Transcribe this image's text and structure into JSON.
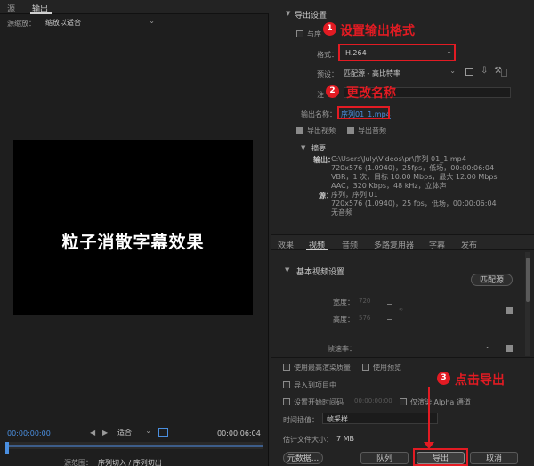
{
  "left_panel": {
    "tab_source": "源",
    "tab_output": "输出",
    "source_zoom_label": "源缩放：",
    "source_zoom_value": "缩放以适合",
    "video_text": "粒子消散字幕效果",
    "timecode_start": "00:00:00:00",
    "fit_value": "适合",
    "timecode_end": "00:00:06:04",
    "source_range_label": "源范围：",
    "source_range_value": "序列切入 / 序列切出"
  },
  "export_settings": {
    "section_title": "导出设置",
    "match_sequence_label": "与序",
    "format_label": "格式：",
    "format_value": "H.264",
    "preset_label": "预设：",
    "preset_value": "匹配源 - 高比特率",
    "comment_label": "注",
    "output_name_label": "输出名称：",
    "output_name_value": "序列01_1.mp4",
    "export_video_label": "导出视频",
    "export_audio_label": "导出音频"
  },
  "summary": {
    "title": "摘要",
    "output_label": "输出：",
    "output_lines": [
      "C:\\Users\\July\\Videos\\pr\\序列 01_1.mp4",
      "720x576 (1.0940)，25fps，低场，00:00:06:04",
      "VBR，1 次，目标 10.00 Mbps，最大 12.00 Mbps",
      "AAC，320 Kbps，48 kHz，立体声"
    ],
    "source_label": "源：",
    "source_lines": [
      "序列，序列 01",
      "720x576 (1.0940)，25 fps，低场，00:00:06:04",
      "无音频"
    ]
  },
  "tabs": [
    "效果",
    "视频",
    "音频",
    "多路复用器",
    "字幕",
    "发布"
  ],
  "video_settings": {
    "title": "基本视频设置",
    "match_source_button": "匹配源",
    "width_label": "宽度：",
    "width_value": "720",
    "height_label": "高度：",
    "height_value": "576",
    "framerate_label": "帧速率："
  },
  "options": {
    "max_render_quality": "使用最高渲染质量",
    "use_previews": "使用预览",
    "import_into_project": "导入到项目中",
    "set_start_timecode": "设置开始时间码",
    "start_timecode_value": "00:00:00:00",
    "render_alpha_only": "仅渲染 Alpha 通道",
    "time_interp_label": "时间插值：",
    "time_interp_value": "帧采样",
    "est_file_size_label": "估计文件大小：",
    "est_file_size_value": "7 MB"
  },
  "buttons": {
    "metadata": "元数据...",
    "queue": "队列",
    "export": "导出",
    "cancel": "取消"
  },
  "annotations": {
    "a1_num": "1",
    "a1_text": "设置输出格式",
    "a2_num": "2",
    "a2_text": "更改名称",
    "a3_num": "3",
    "a3_text": "点击导出"
  }
}
